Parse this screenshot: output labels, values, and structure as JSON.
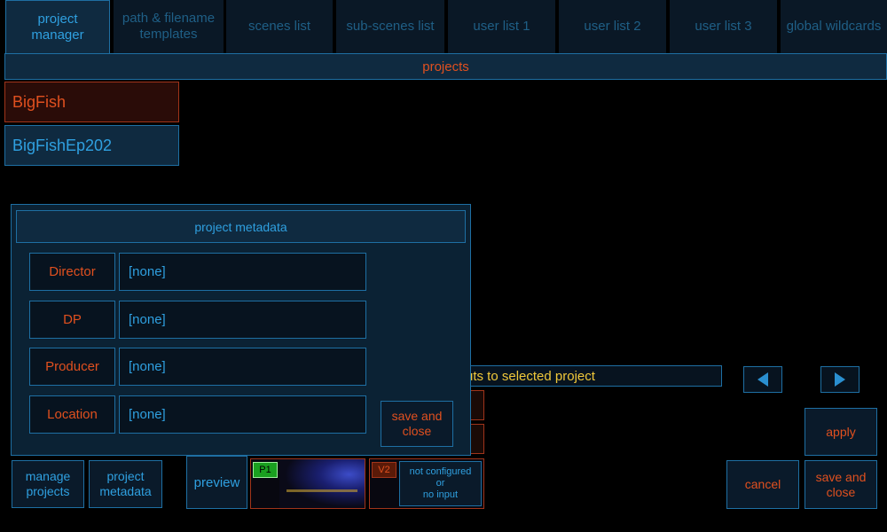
{
  "tabs": [
    {
      "label": "project\nmanager"
    },
    {
      "label": "path & filename\ntemplates"
    },
    {
      "label": "scenes list"
    },
    {
      "label": "sub-scenes list"
    },
    {
      "label": "user list 1"
    },
    {
      "label": "user list 2"
    },
    {
      "label": "user list 3"
    },
    {
      "label": "global wildcards"
    }
  ],
  "projects_header": "projects",
  "projects": [
    "BigFish",
    "BigFishEp202"
  ],
  "status_text": "uts to selected project",
  "modal": {
    "title": "project metadata",
    "fields": [
      {
        "label": "Director",
        "value": "[none]"
      },
      {
        "label": "DP",
        "value": "[none]"
      },
      {
        "label": "Producer",
        "value": "[none]"
      },
      {
        "label": "Location",
        "value": "[none]"
      }
    ],
    "save_close": "save and\nclose"
  },
  "bottom": {
    "manage_projects": "manage\nprojects",
    "project_metadata": "project\nmetadata",
    "preview": "preview",
    "p1_badge": "P1",
    "v2_badge": "V2",
    "v2_status": "not configured\nor\nno input",
    "apply": "apply",
    "cancel": "cancel",
    "save_close": "save and\nclose"
  },
  "colors": {
    "accent_blue": "#2fa0e0",
    "accent_orange": "#e0501f",
    "border": "#1e6fa3"
  }
}
